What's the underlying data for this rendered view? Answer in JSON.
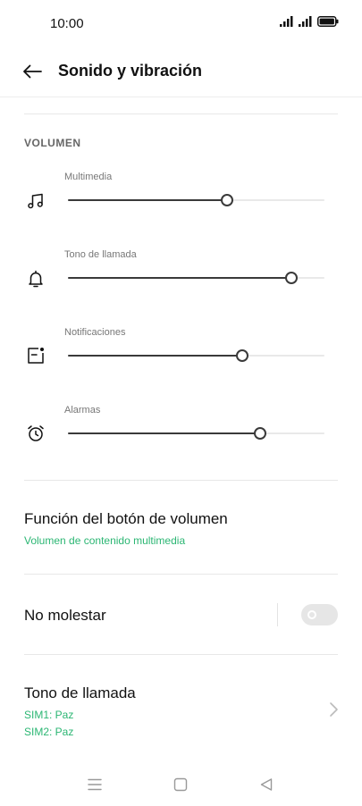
{
  "status_bar": {
    "time": "10:00"
  },
  "header": {
    "title": "Sonido y vibración"
  },
  "volume": {
    "section_title": "VOLUMEN",
    "sliders": [
      {
        "label": "Multimedia",
        "icon": "music-note-icon",
        "level": 0.62
      },
      {
        "label": "Tono de llamada",
        "icon": "bell-icon",
        "level": 0.87
      },
      {
        "label": "Notificaciones",
        "icon": "notification-icon",
        "level": 0.68
      },
      {
        "label": "Alarmas",
        "icon": "alarm-clock-icon",
        "level": 0.75
      }
    ]
  },
  "volume_button_function": {
    "title": "Función del botón de volumen",
    "subtitle": "Volumen de contenido multimedia"
  },
  "do_not_disturb": {
    "title": "No molestar",
    "enabled": false
  },
  "ringtone": {
    "title": "Tono de llamada",
    "sim1": "SIM1: Paz",
    "sim2": "SIM2: Paz"
  },
  "colors": {
    "accent": "#2bb673",
    "slider_fill": "#3a3a3a",
    "slider_track": "#e9e9e9"
  }
}
